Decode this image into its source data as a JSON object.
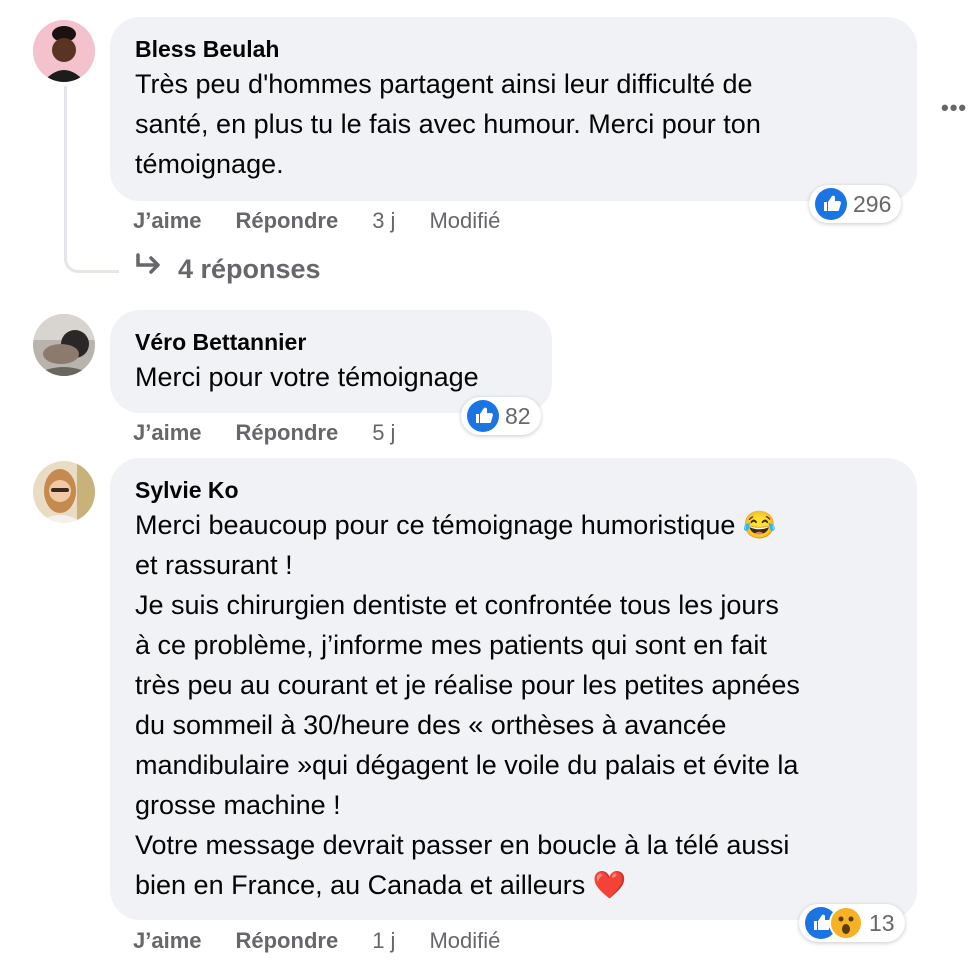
{
  "comments": [
    {
      "author": "Bless Beulah",
      "text": "Très peu d'hommes partagent ainsi leur difficulté de\nsanté, en plus tu le fais avec humour. Merci pour ton\ntémoignage.",
      "like_label": "J’aime",
      "reply_label": "Répondre",
      "time": "3 j",
      "edited": "Modifié",
      "reaction_count": "296",
      "reactions": [
        "like-icon"
      ],
      "replies_label": "4 réponses"
    },
    {
      "author": "Véro Bettannier",
      "text": "Merci pour votre témoignage",
      "like_label": "J’aime",
      "reply_label": "Répondre",
      "time": "5 j",
      "reaction_count": "82",
      "reactions": [
        "like-icon"
      ]
    },
    {
      "author": "Sylvie Ko",
      "text": "Merci beaucoup pour ce témoignage humoristique 😂\net rassurant !\nJe suis chirurgien dentiste et confrontée tous les jours\nà ce problème, j’informe mes patients qui sont en fait\ntrès peu au courant et je réalise pour les petites apnées\ndu sommeil à 30/heure des « orthèses à avancée\nmandibulaire »qui dégagent le voile du palais et évite la\ngrosse machine !\nVotre message devrait passer en boucle à la télé aussi\nbien en France, au Canada et ailleurs ❤️",
      "like_label": "J’aime",
      "reply_label": "Répondre",
      "time": "1 j",
      "edited": "Modifié",
      "reaction_count": "13",
      "reactions": [
        "like-icon",
        "wow-icon"
      ]
    }
  ],
  "colors": {
    "bubble": "#f0f2f5",
    "secondary_text": "#65676b",
    "like_blue": "#1b74e4",
    "wow_yellow": "#f7b125"
  }
}
